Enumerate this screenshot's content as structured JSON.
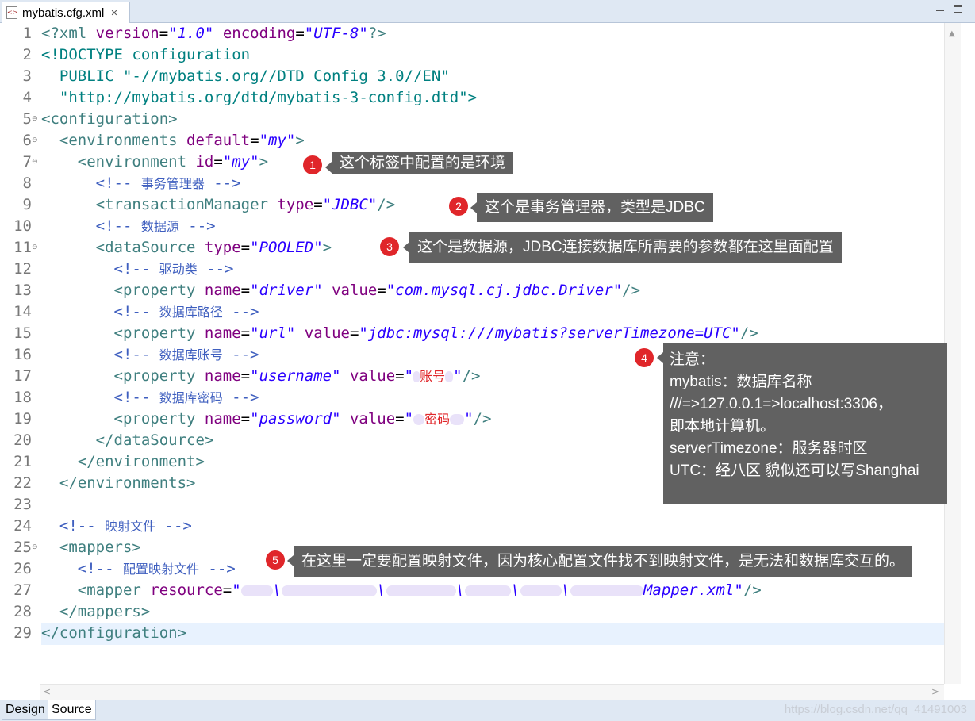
{
  "window": {
    "tab_title": "mybatis.cfg.xml",
    "tab_icon": "xml-file-icon"
  },
  "editor": {
    "lines": [
      {
        "n": "1"
      },
      {
        "n": "2"
      },
      {
        "n": "3"
      },
      {
        "n": "4"
      },
      {
        "n": "5"
      },
      {
        "n": "6"
      },
      {
        "n": "7"
      },
      {
        "n": "8"
      },
      {
        "n": "9"
      },
      {
        "n": "10"
      },
      {
        "n": "11"
      },
      {
        "n": "12"
      },
      {
        "n": "13"
      },
      {
        "n": "14"
      },
      {
        "n": "15"
      },
      {
        "n": "16"
      },
      {
        "n": "17"
      },
      {
        "n": "18"
      },
      {
        "n": "19"
      },
      {
        "n": "20"
      },
      {
        "n": "21"
      },
      {
        "n": "22"
      },
      {
        "n": "23"
      },
      {
        "n": "24"
      },
      {
        "n": "25"
      },
      {
        "n": "26"
      },
      {
        "n": "27"
      },
      {
        "n": "28"
      },
      {
        "n": "29"
      }
    ],
    "code": {
      "l1_open": "<?xml ",
      "l1_attr1": "version",
      "l1_eq1": "=",
      "l1_val1": "\"1.0\"",
      "l1_attr2": " encoding",
      "l1_eq2": "=",
      "l1_val2": "\"UTF-8\"",
      "l1_close": "?>",
      "l2": "<!DOCTYPE configuration",
      "l3": "  PUBLIC \"-//mybatis.org//DTD Config 3.0//EN\"",
      "l4": "  \"http://mybatis.org/dtd/mybatis-3-config.dtd\">",
      "l5": "<configuration>",
      "l6_tag": "  <environments ",
      "l6_attr": "default",
      "l6_val": "\"my\"",
      "l6_close": ">",
      "l7_tag": "    <environment ",
      "l7_attr": "id",
      "l7_val": "\"my\"",
      "l7_close": ">",
      "l8_open": "      <!-- ",
      "l8_text": "事务管理器",
      "l8_close": " -->",
      "l9_tag": "      <transactionManager ",
      "l9_attr": "type",
      "l9_val": "\"JDBC\"",
      "l9_close": "/>",
      "l10_open": "      <!-- ",
      "l10_text": "数据源",
      "l10_close": " -->",
      "l11_tag": "      <dataSource ",
      "l11_attr": "type",
      "l11_val": "\"POOLED\"",
      "l11_close": ">",
      "l12_open": "        <!-- ",
      "l12_text": "驱动类",
      "l12_close": " -->",
      "l13_tag": "        <property ",
      "l13_attr1": "name",
      "l13_val1": "\"driver\"",
      "l13_attr2": " value",
      "l13_val2": "\"com.mysql.cj.jdbc.Driver\"",
      "l13_close": "/>",
      "l14_open": "        <!-- ",
      "l14_text": "数据库路径",
      "l14_close": " -->",
      "l15_tag": "        <property ",
      "l15_attr1": "name",
      "l15_val1": "\"url\"",
      "l15_attr2": " value",
      "l15_val2": "\"jdbc:mysql:///mybatis?serverTimezone=UTC\"",
      "l15_close": "/>",
      "l16_open": "        <!-- ",
      "l16_text": "数据库账号",
      "l16_close": " -->",
      "l17_tag": "        <property ",
      "l17_attr1": "name",
      "l17_val1": "\"username\"",
      "l17_attr2": " value",
      "l17_q1": "\"",
      "l17_red": "账号",
      "l17_q2": "\"",
      "l17_close": "/>",
      "l18_open": "        <!-- ",
      "l18_text": "数据库密码",
      "l18_close": " -->",
      "l19_tag": "        <property ",
      "l19_attr1": "name",
      "l19_val1": "\"password\"",
      "l19_attr2": " value",
      "l19_q1": "\"",
      "l19_red": "密码",
      "l19_q2": "\"",
      "l19_close": "/>",
      "l20": "      </dataSource>",
      "l21": "    </environment>",
      "l22": "  </environments>",
      "l23": "",
      "l24_open": "  <!-- ",
      "l24_text": "映射文件",
      "l24_close": " -->",
      "l25": "  <mappers>",
      "l26_open": "    <!-- ",
      "l26_text": "配置映射文件",
      "l26_close": " -->",
      "l27_tag": "    <mapper ",
      "l27_attr": "resource",
      "l27_q": "\"",
      "l27_sep": "\\",
      "l27_tail": "Mapper.xml\"",
      "l27_close": "/>",
      "l28": "  </mappers>",
      "l29": "</configuration>"
    }
  },
  "annotations": [
    {
      "num": "1",
      "text": "这个标签中配置的是环境"
    },
    {
      "num": "2",
      "text": "这个是事务管理器，类型是JDBC"
    },
    {
      "num": "3",
      "text": "这个是数据源，JDBC连接数据库所需要的参数都在这里面配置"
    },
    {
      "num": "4",
      "text": "注意：\nmybatis：数据库名称\n///=>127.0.0.1=>localhost:3306，\n即本地计算机。\nserverTimezone：服务器时区\nUTC：经八区 貌似还可以写Shanghai"
    },
    {
      "num": "5",
      "text": "在这里一定要配置映射文件，因为核心配置文件找不到映射文件，是无法和数据库交互的。"
    }
  ],
  "bottom_tabs": {
    "design": "Design",
    "source": "Source"
  },
  "watermark": "https://blog.csdn.net/qq_41491003",
  "colors": {
    "tag": "#3f7f7f",
    "attribute": "#7f007f",
    "value": "#2a00ff",
    "comment": "#3f5fbf",
    "badge": "#e0262a",
    "callout": "#616161"
  }
}
